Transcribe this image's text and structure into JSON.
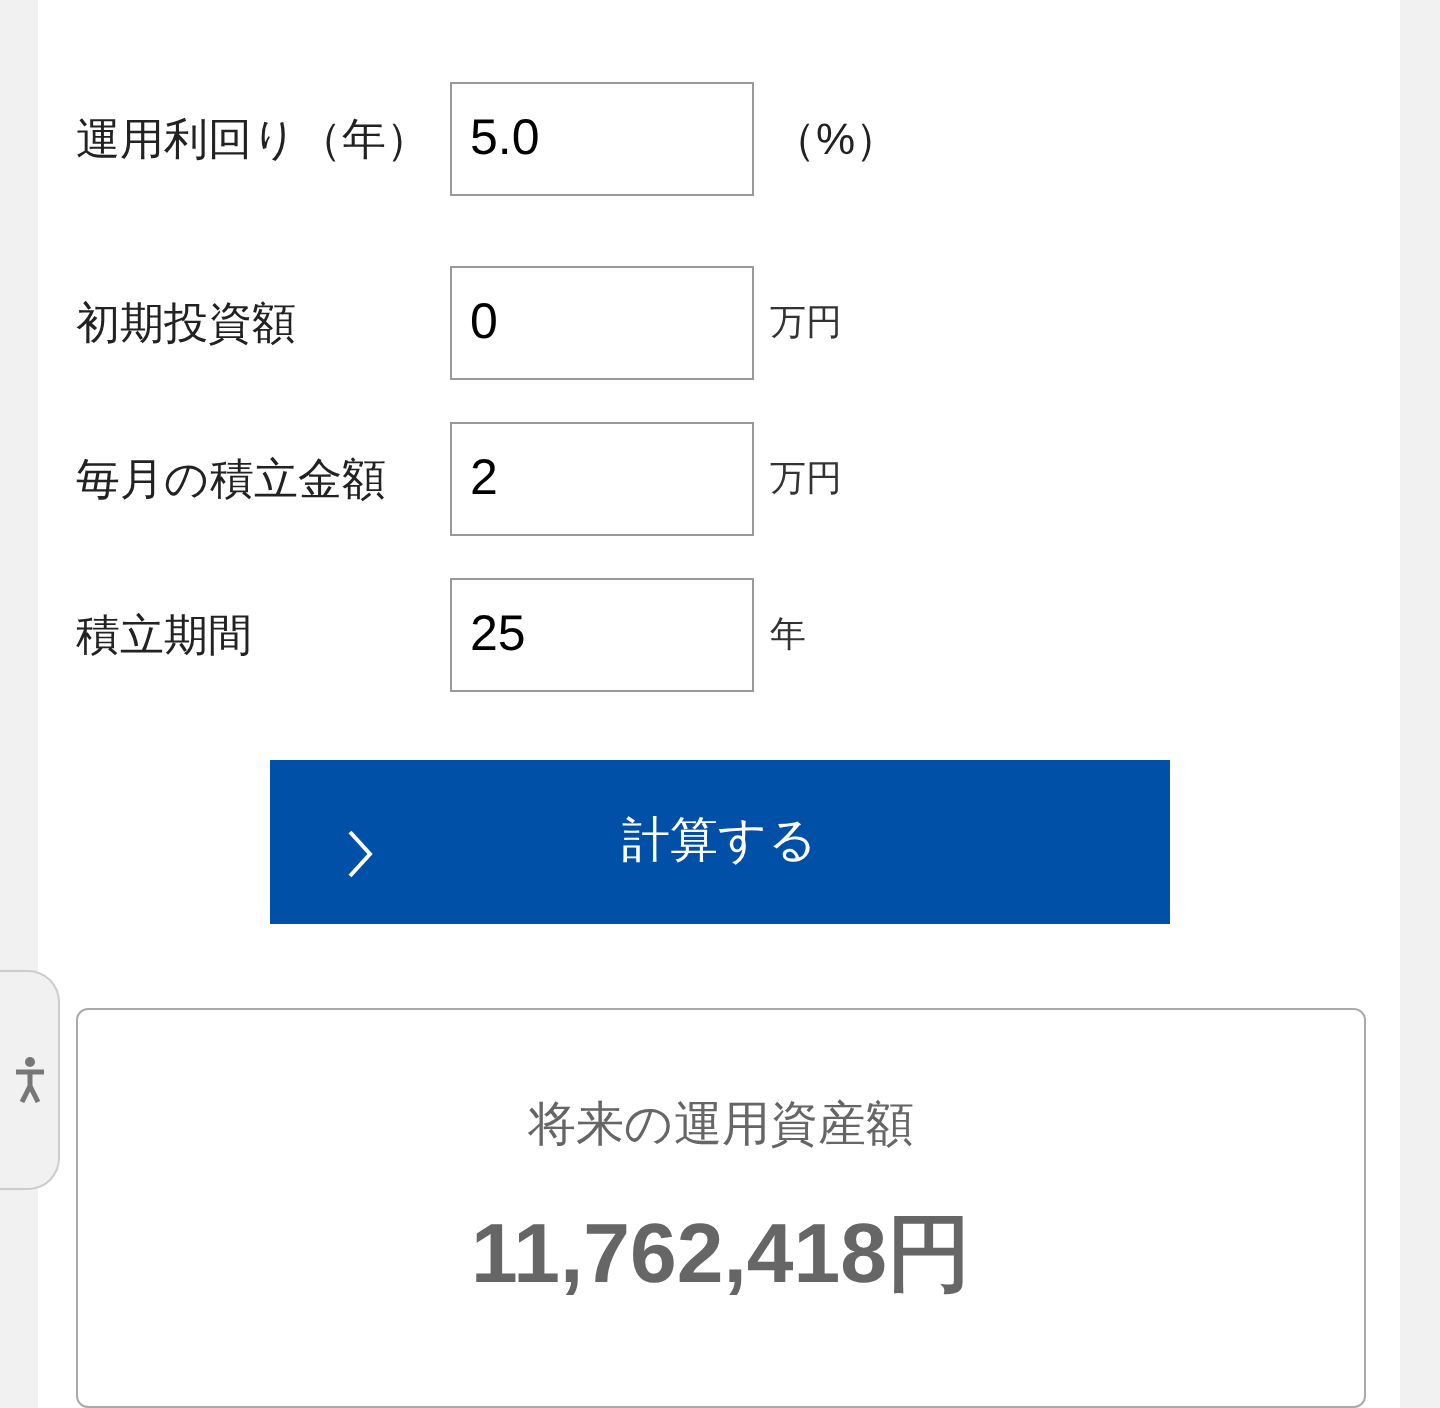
{
  "fields": [
    {
      "label": "運用利回り（年）",
      "value": "5.0",
      "unit": "（%）",
      "kind": "percent"
    },
    {
      "label": "初期投資額",
      "value": "0",
      "unit": "万円",
      "kind": "amount"
    },
    {
      "label": "毎月の積立金額",
      "value": "2",
      "unit": "万円",
      "kind": "amount"
    },
    {
      "label": "積立期間",
      "value": "25",
      "unit": "年",
      "kind": "amount"
    }
  ],
  "calculate_button": {
    "label": "計算する"
  },
  "result": {
    "title": "将来の運用資産額",
    "amount": "11,762,418円"
  }
}
